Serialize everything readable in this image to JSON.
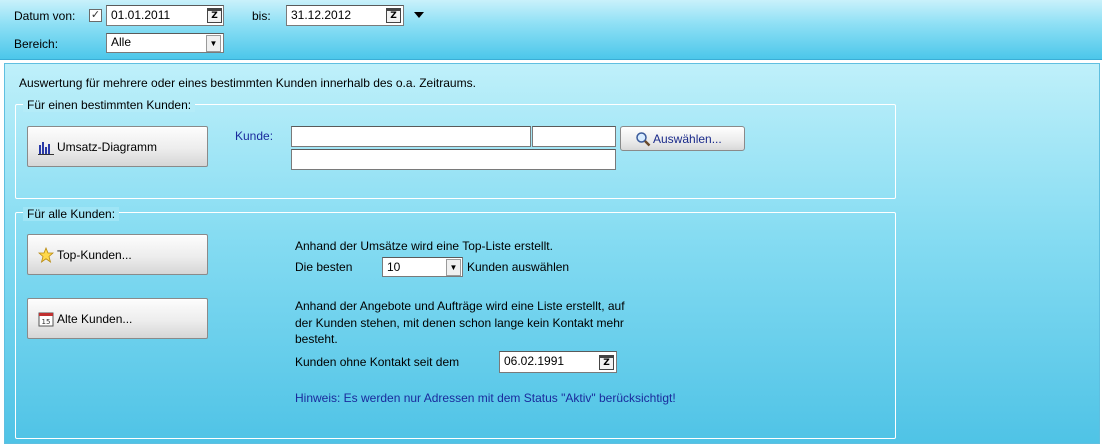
{
  "toolbar": {
    "date_from_label": "Datum von:",
    "date_from_checked": true,
    "date_from_value": "01.01.2011",
    "date_to_label": "bis:",
    "date_to_value": "31.12.2012",
    "range_label": "Bereich:",
    "range_value": "Alle"
  },
  "main": {
    "intro_text": "Auswertung für mehrere oder eines bestimmten Kunden innerhalb des o.a. Zeitraums.",
    "single_customer": {
      "group_title": "Für einen bestimmten Kunden:",
      "chart_button_label": "Umsatz-Diagramm",
      "customer_label": "Kunde:",
      "customer_name_value": "",
      "customer_number_value": "",
      "customer_extra_value": "",
      "select_button_label": "Auswählen..."
    },
    "all_customers": {
      "group_title": "Für alle Kunden:",
      "top_button_label": "Top-Kunden...",
      "top_desc": "Anhand der Umsätze wird eine Top-Liste erstellt.",
      "top_best_label": "Die besten",
      "top_count_value": "10",
      "top_select_label": "Kunden auswählen",
      "old_button_label": "Alte Kunden...",
      "old_desc_line1": "Anhand der Angebote und Aufträge wird eine Liste erstellt, auf",
      "old_desc_line2": "der Kunden stehen, mit denen schon lange  kein Kontakt mehr",
      "old_desc_line3": "besteht.",
      "no_contact_label": "Kunden ohne Kontakt seit dem",
      "no_contact_date": "06.02.1991",
      "hint_text": "Hinweis: Es werden nur Adressen mit dem Status \"Aktiv\" berücksichtigt!"
    }
  },
  "colors": {
    "header_gradient_top": "#c9f1fb",
    "header_gradient_bottom": "#4cc7ea",
    "link_blue": "#1a2a9c"
  }
}
